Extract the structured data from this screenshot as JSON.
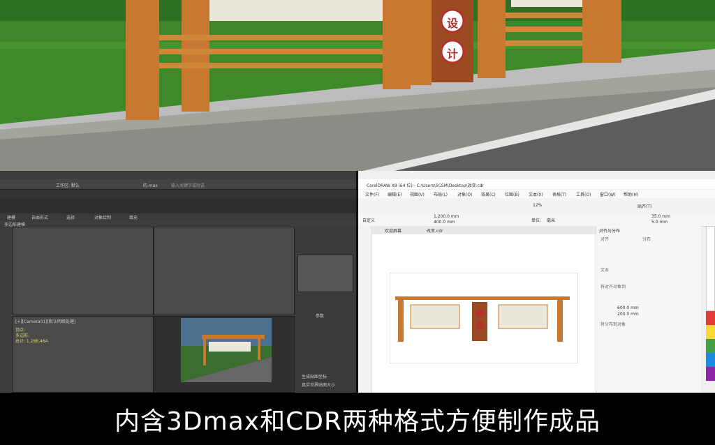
{
  "scene": {
    "sign_chars": [
      "设",
      "计"
    ]
  },
  "max_window": {
    "title_workspace": "工作区: 默认",
    "title_file": "的.max",
    "search_placeholder": "输入关键字或短语",
    "tab_modeling": "建模",
    "tab_freeform": "自由形式",
    "tab_selection": "选择",
    "tab_object_paint": "对象绘制",
    "tab_populate": "填充",
    "subtitle": "多边形建模",
    "viewport_camera": "[+][Camera01][默认明暗处理]",
    "readout": [
      "顶点:",
      "多边形:",
      "总计: 1,288,464"
    ],
    "panel_label": "参数",
    "option_1": "生成贴图坐标",
    "option_2": "真实世界贴图大小"
  },
  "cdr_window": {
    "title": "CorelDRAW X8 (64 位) - C:\\Users\\SCSM\\Desktop\\改变.cdr",
    "menu": [
      "文件(F)",
      "编辑(E)",
      "视图(V)",
      "布局(L)",
      "对象(O)",
      "效果(C)",
      "位图(B)",
      "文本(X)",
      "表格(T)",
      "工具(O)",
      "窗口(W)",
      "帮助(H)"
    ],
    "preset": "自定义",
    "width": "1,200.0 mm",
    "height": "400.0 mm",
    "zoom": "12%",
    "units_label": "单位:",
    "units": "毫米",
    "snap": "贴齐(T)",
    "dim_x": "35.0 mm",
    "dim_y": "5.0 mm",
    "tab_welcome": "欢迎屏幕",
    "tab_doc": "改变.cdr",
    "dock_title": "对齐与分布",
    "dock_align": "对齐",
    "dock_distribute": "分布",
    "dock_text": "文本",
    "dock_align_to": "将对齐对象到",
    "dock_distribute_to": "将分布到对象",
    "val_x": "600.0 mm",
    "val_y": "200.0 mm"
  },
  "caption": "内含3Dmax和CDR两种格式方便制作成品",
  "colors": {
    "wood": "#c8782f",
    "grass": "#3f8a2c",
    "road": "#5d5d60",
    "max_bg": "#3d3d3d",
    "cdr_bg": "#f0f0f0"
  }
}
